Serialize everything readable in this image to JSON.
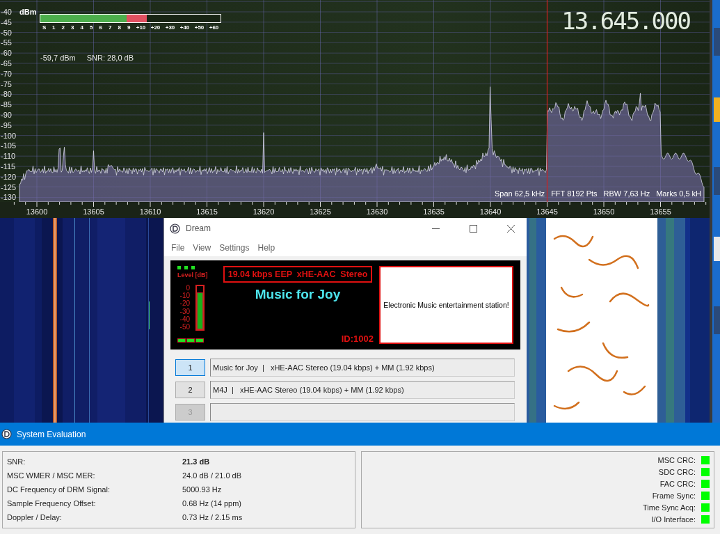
{
  "spectrum": {
    "unit": "dBm",
    "y_labels": [
      "-40",
      "-45",
      "-50",
      "-55",
      "-60",
      "-65",
      "-70",
      "-75",
      "-80",
      "-85",
      "-90",
      "-95",
      "-100",
      "-105",
      "-110",
      "-115",
      "-120",
      "-125",
      "-130"
    ],
    "x_labels": [
      "13600",
      "13605",
      "13610",
      "13615",
      "13620",
      "13625",
      "13630",
      "13635",
      "13640",
      "13645",
      "13650",
      "13655"
    ],
    "s_meter": {
      "level": 0.59,
      "scale": [
        "S",
        "1",
        "2",
        "3",
        "4",
        "5",
        "6",
        "7",
        "8",
        "9",
        "+10",
        "+20",
        "+30",
        "+40",
        "+50",
        "+60"
      ]
    },
    "power": "-59,7 dBm",
    "snr": "SNR: 28,0 dB",
    "frequency": "13.645.000",
    "info": [
      "Span 62,5 kHz",
      "FFT 8192 Pts",
      "RBW 7,63 Hz",
      "Marks 0,5 kH"
    ]
  },
  "dream": {
    "title": "Dream",
    "menu": [
      "File",
      "View",
      "Settings",
      "Help"
    ],
    "display": {
      "leds_top": [
        {
          "on": true
        },
        {
          "on": true
        },
        {
          "on": true
        }
      ],
      "level_label": "Level [dB]",
      "level_scale": [
        "0",
        "-10",
        "-20",
        "-30",
        "-40",
        "-50"
      ],
      "level": 0.85,
      "leds_bottom": [
        {
          "on": true
        },
        {
          "on": true
        },
        {
          "on": true
        }
      ],
      "bitrate": "19.04 kbps EEP  xHE-AAC  Stereo",
      "station": "Music for Joy",
      "id": "ID:1002",
      "text_message": "Electronic Music entertainment station!"
    },
    "services": [
      {
        "number": "1",
        "selected": true,
        "disabled": false,
        "label": "Music for Joy  |   xHE-AAC Stereo (19.04 kbps) + MM (1.92 kbps)"
      },
      {
        "number": "2",
        "selected": false,
        "disabled": false,
        "label": "M4J  |   xHE-AAC Stereo (19.04 kbps) + MM (1.92 kbps)"
      },
      {
        "number": "3",
        "selected": false,
        "disabled": true
      }
    ]
  },
  "system_evaluation": {
    "title": "System Evaluation",
    "measurements": [
      {
        "label": "SNR:",
        "value": "21.3 dB",
        "emphasis": true
      },
      {
        "label": "MSC WMER / MSC MER:",
        "value": "24.0 dB / 21.0 dB",
        "emphasis": false
      },
      {
        "label": "DC Frequency of DRM Signal:",
        "value": "5000.93 Hz",
        "emphasis": false
      },
      {
        "label": "Sample Frequency Offset:",
        "value": "0.68 Hz (14 ppm)",
        "emphasis": false
      },
      {
        "label": "Doppler / Delay:",
        "value": "0.73 Hz / 2.15 ms",
        "emphasis": false
      }
    ],
    "status": [
      {
        "label": "MSC CRC:",
        "ok": true
      },
      {
        "label": "SDC CRC:",
        "ok": true
      },
      {
        "label": "FAC CRC:",
        "ok": true
      },
      {
        "label": "Frame Sync:",
        "ok": true
      },
      {
        "label": "Time Sync Acq:",
        "ok": true
      },
      {
        "label": "I/O Interface:",
        "ok": true
      }
    ]
  }
}
